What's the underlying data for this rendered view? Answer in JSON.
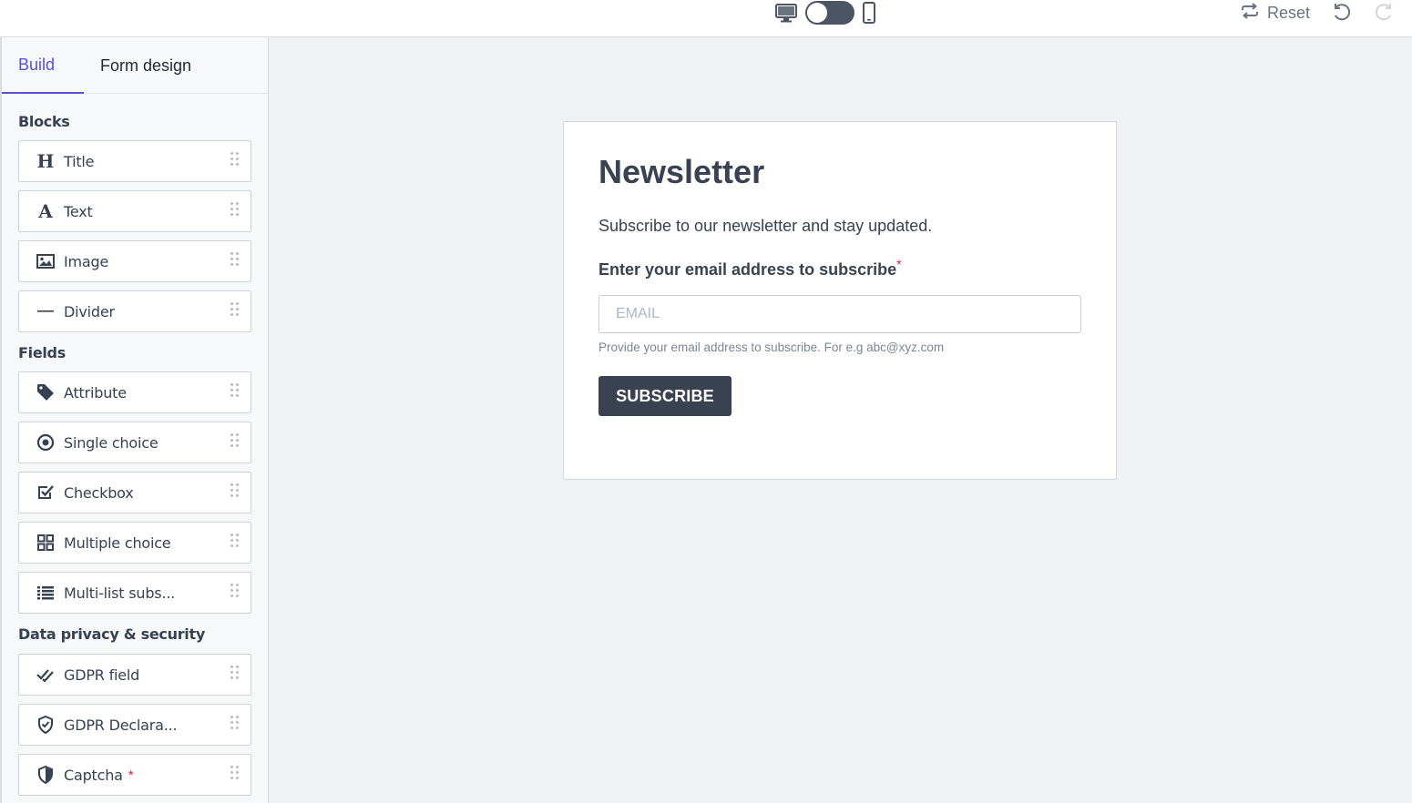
{
  "topbar": {
    "desktop_icon": "desktop-monitor-icon",
    "mobile_icon": "mobile-phone-icon",
    "reset_label": "Reset",
    "reset_icon": "repeat-arrows-icon",
    "undo_icon": "undo-icon",
    "redo_icon": "redo-icon"
  },
  "sidebar": {
    "tabs": [
      {
        "label": "Build",
        "active": true
      },
      {
        "label": "Form design",
        "active": false
      }
    ],
    "sections": [
      {
        "title": "Blocks",
        "items": [
          {
            "label": "Title",
            "icon": "heading-icon"
          },
          {
            "label": "Text",
            "icon": "text-icon"
          },
          {
            "label": "Image",
            "icon": "image-icon"
          },
          {
            "label": "Divider",
            "icon": "divider-icon"
          }
        ]
      },
      {
        "title": "Fields",
        "items": [
          {
            "label": "Attribute",
            "icon": "tag-icon"
          },
          {
            "label": "Single choice",
            "icon": "radio-icon"
          },
          {
            "label": "Checkbox",
            "icon": "checkbox-icon"
          },
          {
            "label": "Multiple choice",
            "icon": "grid-icon"
          },
          {
            "label": "Multi-list subs...",
            "icon": "list-icon"
          }
        ]
      },
      {
        "title": "Data privacy & security",
        "items": [
          {
            "label": "GDPR field",
            "icon": "double-check-icon"
          },
          {
            "label": "GDPR Declara...",
            "icon": "shield-check-icon"
          },
          {
            "label": "Captcha",
            "icon": "shield-icon",
            "required_mark": "*"
          }
        ]
      }
    ]
  },
  "form": {
    "title": "Newsletter",
    "description": "Subscribe to our newsletter and stay updated.",
    "email_label": "Enter your email address to subscribe",
    "required_mark": "*",
    "email_placeholder": "EMAIL",
    "help_text": "Provide your email address to subscribe. For e.g abc@xyz.com",
    "button_label": "SUBSCRIBE"
  },
  "colors": {
    "accent": "#5b50d6",
    "button_bg": "#3a4251",
    "required": "#e11d48",
    "canvas_bg": "#eff1f5"
  }
}
